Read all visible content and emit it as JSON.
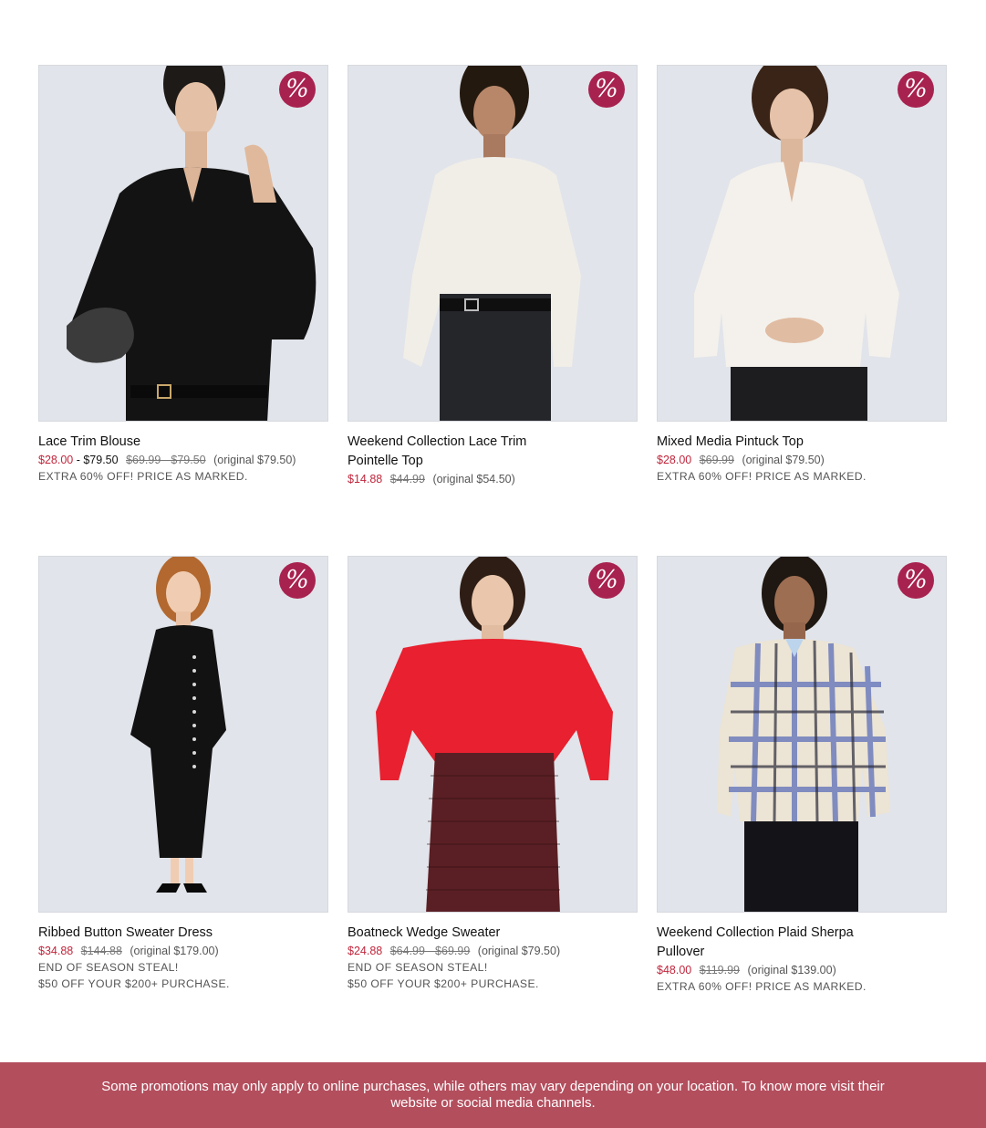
{
  "colors": {
    "badge": "#a8224f",
    "sale_price": "#c0263c",
    "footer_bg": "#b34e5d"
  },
  "badge_symbol": "%",
  "products": [
    {
      "name": "Lace Trim Blouse",
      "sale": "$28.00",
      "dash": " - ",
      "regular": "$79.50",
      "was": "$69.99 - $79.50",
      "original": "(original $79.50)",
      "promo": [
        "EXTRA 60% OFF! PRICE AS MARKED."
      ],
      "icon": "percent-badge-icon"
    },
    {
      "name": "Weekend Collection Lace Trim Pointelle Top",
      "sale": "$14.88",
      "was": "$44.99",
      "original": "(original $54.50)",
      "promo": [],
      "icon": "percent-badge-icon"
    },
    {
      "name": "Mixed Media Pintuck Top",
      "sale": "$28.00",
      "was": "$69.99",
      "original": "(original $79.50)",
      "promo": [
        "EXTRA 60% OFF! PRICE AS MARKED."
      ],
      "icon": "percent-badge-icon"
    },
    {
      "name": "Ribbed Button Sweater Dress",
      "sale": "$34.88",
      "was": "$144.88",
      "original": "(original $179.00)",
      "promo": [
        "END OF SEASON STEAL!",
        "$50 OFF YOUR $200+ PURCHASE."
      ],
      "icon": "percent-badge-icon"
    },
    {
      "name": "Boatneck Wedge Sweater",
      "sale": "$24.88",
      "was": "$64.99 - $69.99",
      "original": "(original $79.50)",
      "promo": [
        "END OF SEASON STEAL!",
        "$50 OFF YOUR $200+ PURCHASE."
      ],
      "icon": "percent-badge-icon"
    },
    {
      "name": "Weekend Collection Plaid Sherpa Pullover",
      "sale": "$48.00",
      "was": "$119.99",
      "original": "(original $139.00)",
      "promo": [
        "EXTRA 60% OFF! PRICE AS MARKED."
      ],
      "icon": "percent-badge-icon"
    }
  ],
  "footer": {
    "text": "Some promotions may only apply to online purchases, while others may vary depending on your location. To know more visit their website or social media channels."
  }
}
